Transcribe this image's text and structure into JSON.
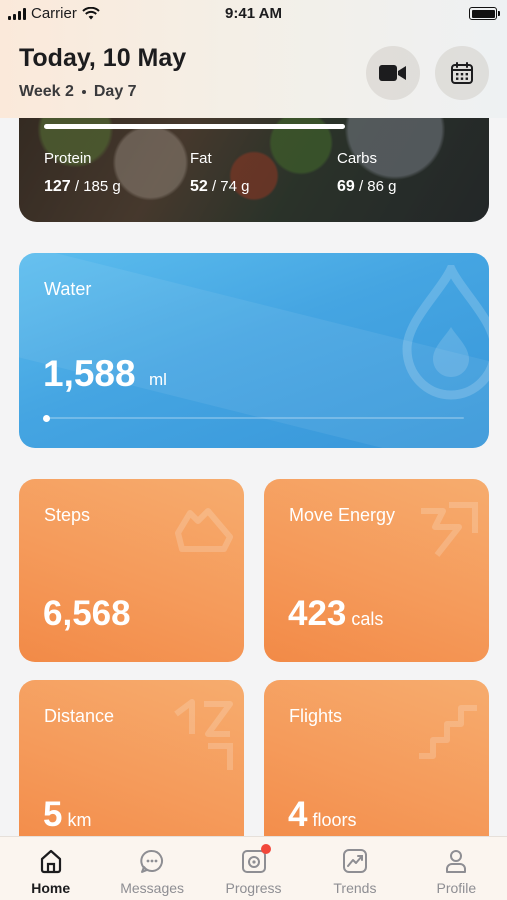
{
  "status_bar": {
    "carrier": "Carrier",
    "time": "9:41 AM"
  },
  "header": {
    "title": "Today, 10 May",
    "week": "Week 2",
    "day": "Day 7",
    "video_icon": "video-camera-icon",
    "calendar_icon": "calendar-icon"
  },
  "nutrition": {
    "progress": 0.7,
    "macros": [
      {
        "label": "Protein",
        "value": "127",
        "total": " / 185 g"
      },
      {
        "label": "Fat",
        "value": "52",
        "total": " / 74 g"
      },
      {
        "label": "Carbs",
        "value": "69",
        "total": " / 86 g"
      }
    ]
  },
  "water": {
    "label": "Water",
    "value": "1,588",
    "unit": "ml",
    "progress": 0.0
  },
  "tiles": {
    "steps": {
      "label": "Steps",
      "value": "6,568",
      "unit": ""
    },
    "move": {
      "label": "Move Energy",
      "value": "423",
      "unit": "cals"
    },
    "distance": {
      "label": "Distance",
      "value": "5",
      "unit": "km"
    },
    "flights": {
      "label": "Flights",
      "value": "4",
      "unit": "floors"
    }
  },
  "tabs": [
    {
      "label": "Home",
      "icon": "home-icon",
      "active": true
    },
    {
      "label": "Messages",
      "icon": "chat-bubble-icon",
      "active": false
    },
    {
      "label": "Progress",
      "icon": "camera-progress-icon",
      "active": false,
      "badge": true
    },
    {
      "label": "Trends",
      "icon": "trend-chart-icon",
      "active": false
    },
    {
      "label": "Profile",
      "icon": "person-icon",
      "active": false
    }
  ],
  "colors": {
    "water_gradient": "#45a5e2",
    "tile_orange": "#f59a5a",
    "badge_red": "#f2473a"
  }
}
